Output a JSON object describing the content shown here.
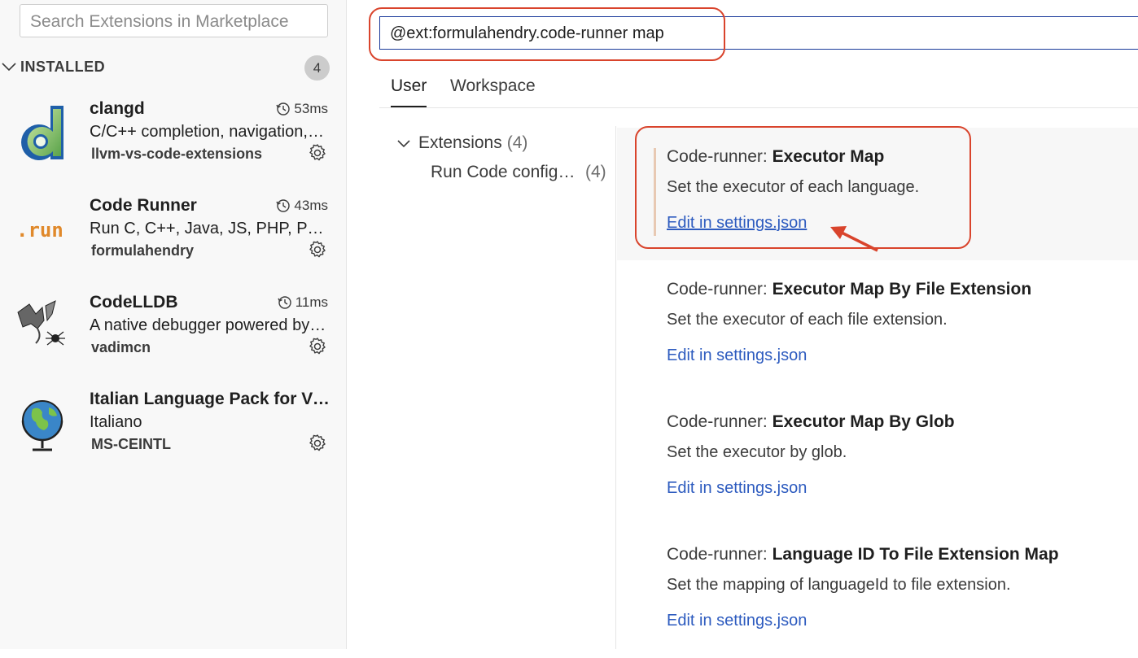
{
  "sidebar": {
    "search_placeholder": "Search Extensions in Marketplace",
    "section_label": "INSTALLED",
    "section_count": "4",
    "extensions": [
      {
        "name": "clangd",
        "time": "53ms",
        "description": "C/C++ completion, navigation, and insights",
        "publisher": "llvm-vs-code-extensions",
        "icon": "clangd-logo-icon"
      },
      {
        "name": "Code Runner",
        "time": "43ms",
        "description": "Run C, C++, Java, JS, PHP, Python, Perl, Ruby, Go",
        "publisher": "formulahendry",
        "icon": "run-logo-icon"
      },
      {
        "name": "CodeLLDB",
        "time": "11ms",
        "description": "A native debugger powered by LLDB",
        "publisher": "vadimcn",
        "icon": "lldb-dragon-icon"
      },
      {
        "name": "Italian Language Pack for Visual Studio Code",
        "time": "",
        "description": "Italiano",
        "publisher": "MS-CEINTL",
        "icon": "globe-icon"
      }
    ]
  },
  "settings": {
    "search_value": "@ext:formulahendry.code-runner map",
    "tabs": [
      "User",
      "Workspace"
    ],
    "active_tab": "User",
    "toc": {
      "group_label": "Extensions",
      "group_count": "(4)",
      "sub_label": "Run Code configuration",
      "sub_count": "(4)"
    },
    "items": [
      {
        "category": "Code-runner: ",
        "name": "Executor Map",
        "description": "Set the executor of each language.",
        "link": "Edit in settings.json"
      },
      {
        "category": "Code-runner: ",
        "name": "Executor Map By File Extension",
        "description": "Set the executor of each file extension.",
        "link": "Edit in settings.json"
      },
      {
        "category": "Code-runner: ",
        "name": "Executor Map By Glob",
        "description": "Set the executor by glob.",
        "link": "Edit in settings.json"
      },
      {
        "category": "Code-runner: ",
        "name": "Language ID To File Extension Map",
        "description": "Set the mapping of languageId to file extension.",
        "link": "Edit in settings.json"
      }
    ]
  },
  "colors": {
    "annotation": "#d9442c",
    "link": "#2d5bbf",
    "accent_border": "#1a3a9a"
  }
}
